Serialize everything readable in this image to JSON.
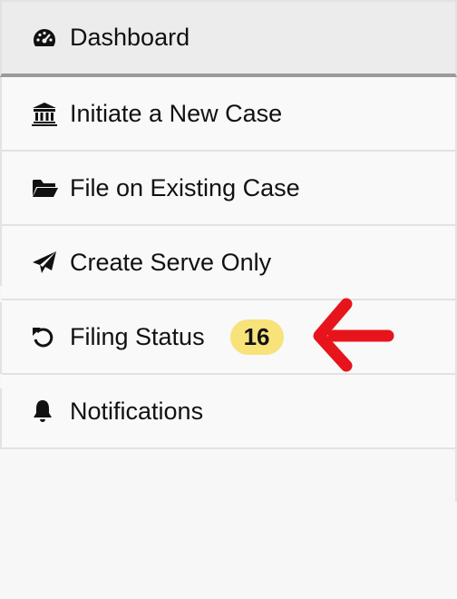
{
  "nav": {
    "items": [
      {
        "label": "Dashboard",
        "icon": "dashboard-gauge-icon"
      },
      {
        "label": "Initiate a New Case",
        "icon": "bank-building-icon"
      },
      {
        "label": "File on Existing Case",
        "icon": "folder-open-icon"
      },
      {
        "label": "Create Serve Only",
        "icon": "paper-plane-icon"
      },
      {
        "label": "Filing Status",
        "icon": "refresh-undo-icon",
        "badge": "16"
      },
      {
        "label": "Notifications",
        "icon": "bell-icon"
      }
    ]
  },
  "colors": {
    "badge_bg": "#f8e27a",
    "annotation_arrow": "#e8141c",
    "active_underline": "#9a9a9a"
  }
}
